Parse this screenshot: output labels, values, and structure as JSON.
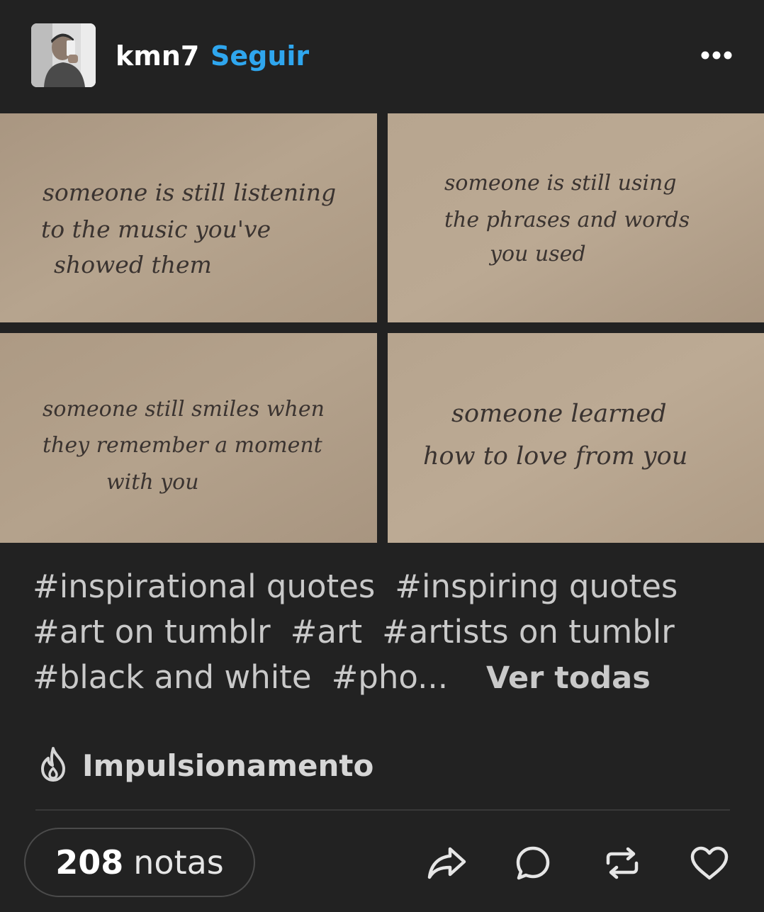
{
  "header": {
    "username": "kmn7",
    "follow_label": "Seguir",
    "avatar_icon": "user-avatar",
    "more_icon": "more-dots-icon"
  },
  "photos": [
    {
      "lines": [
        "someone is still listening",
        "to the music you've",
        "showed them"
      ]
    },
    {
      "lines": [
        "someone is still using",
        "the phrases and words",
        "you used"
      ]
    },
    {
      "lines": [
        "someone still smiles when",
        "they remember a moment",
        "with you"
      ]
    },
    {
      "lines": [
        "someone learned",
        "how to love from you"
      ]
    }
  ],
  "tags": {
    "row1": [
      "#inspirational quotes",
      "#inspiring quotes"
    ],
    "row2": [
      "#art on tumblr",
      "#art",
      "#artists on tumblr"
    ],
    "row3": [
      "#black and white",
      "#pho..."
    ],
    "see_all": "Ver todas"
  },
  "boost": {
    "label": "Impulsionamento",
    "icon": "flame-icon"
  },
  "footer": {
    "notes_count": "208",
    "notes_label": "notas",
    "actions": [
      "share-icon",
      "reply-icon",
      "reblog-icon",
      "like-icon"
    ]
  },
  "colors": {
    "background": "#222222",
    "accent": "#2fa6ee",
    "paper": "#b3a28c"
  }
}
